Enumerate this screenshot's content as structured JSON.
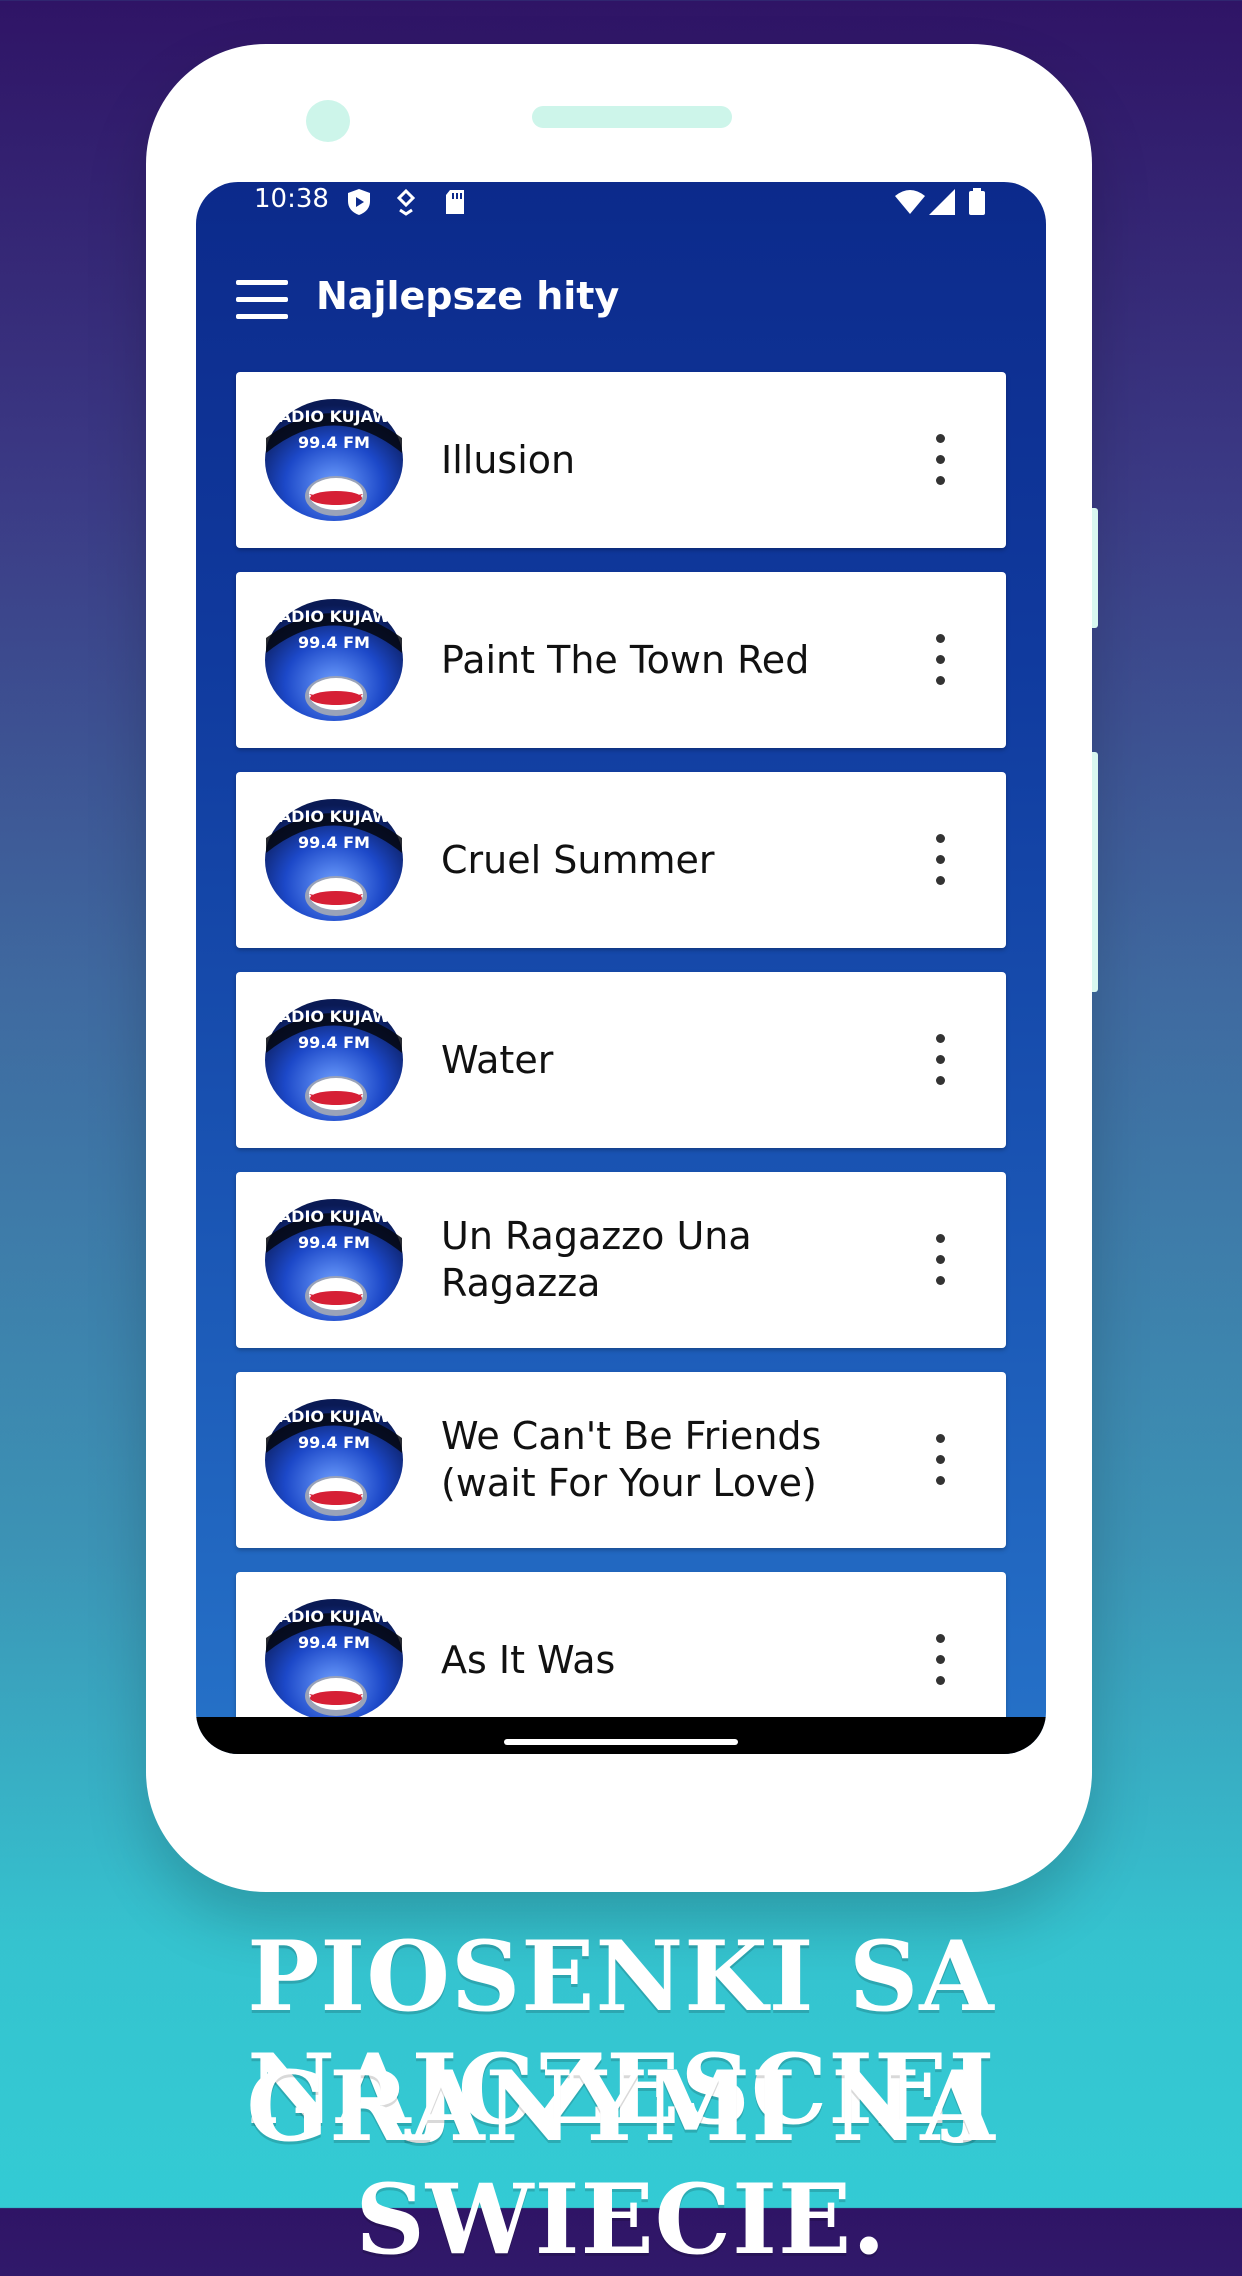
{
  "status_bar": {
    "time": "10:38"
  },
  "app_bar": {
    "title": "Najlepsze hity"
  },
  "thumbnail": {
    "line1": "RADIO KUJAWY",
    "line2": "99.4 FM"
  },
  "songs": [
    {
      "title": "Illusion"
    },
    {
      "title": "Paint The Town Red"
    },
    {
      "title": "Cruel Summer"
    },
    {
      "title": "Water"
    },
    {
      "title": "Un Ragazzo Una Ragazza"
    },
    {
      "title": "We Can't Be Friends (wait For Your Love)"
    },
    {
      "title": "As It Was"
    }
  ],
  "caption": {
    "line1": "PIOSENKI SA NAJCZESCIEJ",
    "line2": "GRANYMI NA SWIECIE."
  },
  "colors": {
    "app_blue": "#0c2a8b",
    "flag_red": "#c8102e",
    "bg_top": "#2f1466",
    "bg_bottom": "#33cbd4"
  },
  "icons": [
    "menu-icon",
    "more-vert-icon",
    "wifi-icon",
    "signal-icon",
    "battery-icon",
    "play-protect-icon",
    "download-icon",
    "sd-card-icon"
  ]
}
